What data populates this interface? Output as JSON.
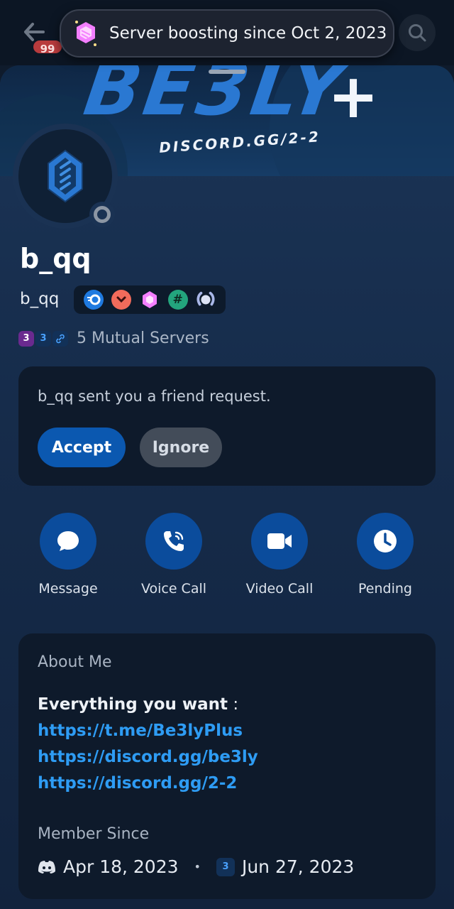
{
  "topbar": {
    "badge_count": "99",
    "tooltip_text": "Server boosting since Oct 2, 2023"
  },
  "banner": {
    "title": "BE3LY",
    "plus": "+",
    "subtitle": "DISCORD.GG/2-2"
  },
  "profile": {
    "display_name": "b_qq",
    "username": "b_qq",
    "badges": [
      "speed-badge-icon",
      "chevron-badge-icon",
      "boost-badge-icon",
      "hashtag-badge-icon",
      "laurel-badge-icon"
    ],
    "mutual_servers": "5 Mutual Servers",
    "mutual_icons": [
      "3",
      "3",
      "link"
    ]
  },
  "friend_request": {
    "text": "b_qq sent you a friend request.",
    "accept_label": "Accept",
    "ignore_label": "Ignore"
  },
  "actions": [
    {
      "label": "Message",
      "icon": "chat-bubble-icon"
    },
    {
      "label": "Voice Call",
      "icon": "phone-icon"
    },
    {
      "label": "Video Call",
      "icon": "video-camera-icon"
    },
    {
      "label": "Pending",
      "icon": "clock-icon"
    }
  ],
  "about": {
    "heading": "About Me",
    "bold_line": "Everything you want",
    "colon": " :",
    "links": [
      "https://t.me/Be3lyPlus",
      "https://discord.gg/be3ly",
      "https://discord.gg/2-2"
    ]
  },
  "member_since": {
    "heading": "Member Since",
    "discord_date": "Apr 18, 2023",
    "server_date": "Jun 27, 2023"
  },
  "colors": {
    "accent": "#0b58b0",
    "link": "#2e9cf4",
    "action_circle": "#0b4c9c"
  }
}
